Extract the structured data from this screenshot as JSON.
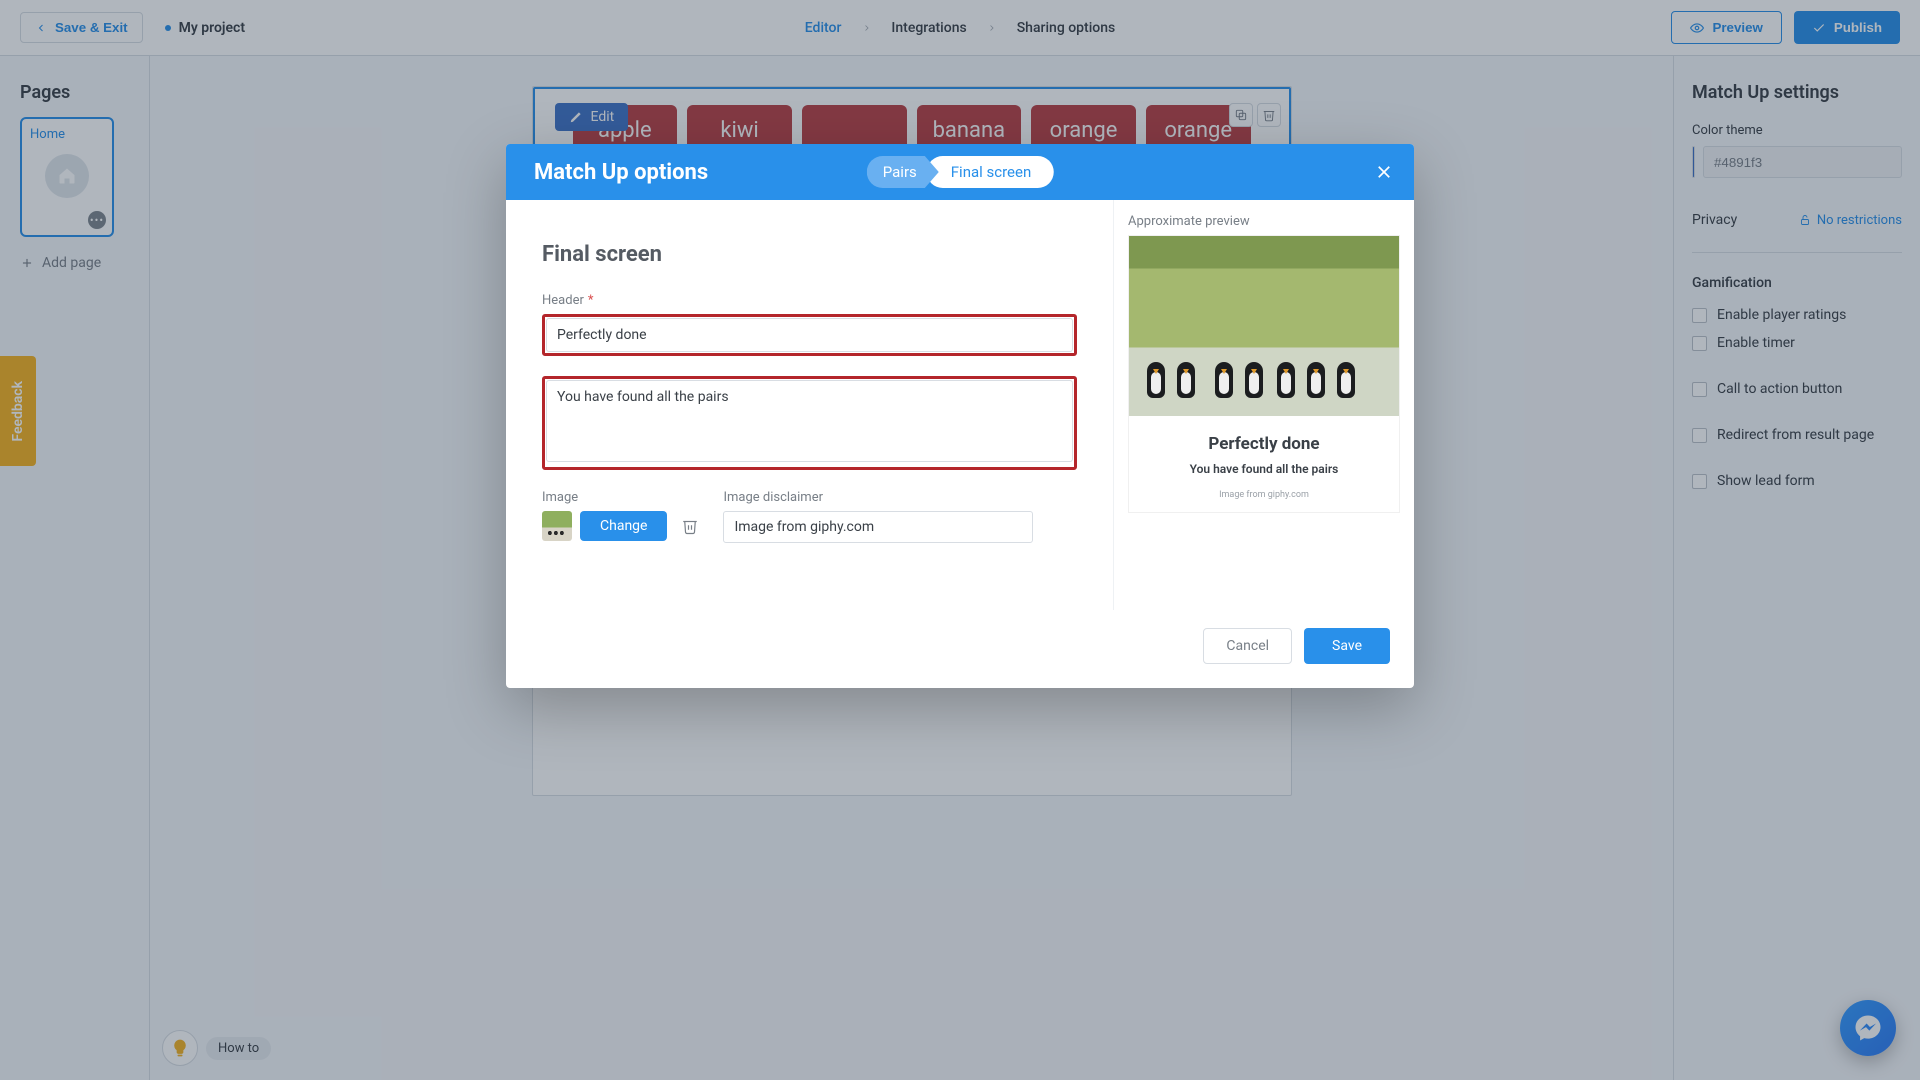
{
  "topbar": {
    "save_exit": "Save & Exit",
    "project": "My project",
    "breadcrumbs": {
      "editor": "Editor",
      "integrations": "Integrations",
      "sharing": "Sharing options"
    },
    "preview": "Preview",
    "publish": "Publish"
  },
  "left": {
    "title": "Pages",
    "page1": "Home",
    "add": "Add page"
  },
  "right": {
    "title": "Match Up settings",
    "color_label": "Color theme",
    "color_hex": "#4891f3",
    "privacy_label": "Privacy",
    "privacy_value": "No restrictions",
    "gamification": "Gamification",
    "ratings": "Enable player ratings",
    "timer": "Enable timer",
    "cta": "Call to action button",
    "redirect": "Redirect from result page",
    "lead": "Show lead form"
  },
  "canvas": {
    "edit": "Edit",
    "cards": [
      "apple",
      "kiwi",
      "",
      "banana",
      "orange",
      "orange"
    ],
    "howto": "How to"
  },
  "feedback": "Feedback",
  "modal": {
    "title": "Match Up options",
    "tab_pairs": "Pairs",
    "tab_final": "Final screen",
    "section": "Final screen",
    "header_label": "Header",
    "header_value": "Perfectly done",
    "body_value": "You have found all the pairs",
    "image_label": "Image",
    "change": "Change",
    "disclaimer_label": "Image disclaimer",
    "disclaimer_value": "Image from giphy.com",
    "preview_cap": "Approximate preview",
    "preview_title": "Perfectly done",
    "preview_sub": "You have found all the pairs",
    "preview_disc": "Image from giphy.com",
    "cancel": "Cancel",
    "save": "Save"
  }
}
